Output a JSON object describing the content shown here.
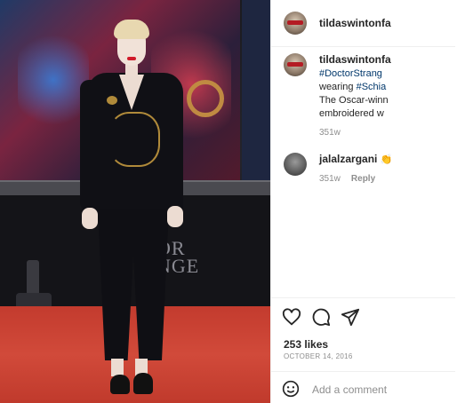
{
  "post": {
    "author": "tildaswintonfa",
    "caption": {
      "author": "tildaswintonfa",
      "hashtag_1": "#DoctorStrang",
      "line_2_prefix": "wearing ",
      "hashtag_2": "#Schia",
      "line_3": "The Oscar-winn",
      "line_4": "embroidered w",
      "time": "351w"
    },
    "comment": {
      "author": "jalalzargani",
      "emoji": "👏",
      "time": "351w",
      "reply_label": "Reply"
    },
    "likes": "253 likes",
    "date": "OCTOBER 14, 2016",
    "add_comment_placeholder": "Add a comment"
  },
  "photo": {
    "logo_line_1": "OR",
    "logo_line_2": "NGE"
  },
  "icons": {
    "like": "heart-icon",
    "comment": "comment-icon",
    "share": "share-icon",
    "emoji": "emoji-icon"
  },
  "colors": {
    "link": "#00376b",
    "secondary_text": "#8e8e8e",
    "carpet": "#c33b2e"
  }
}
